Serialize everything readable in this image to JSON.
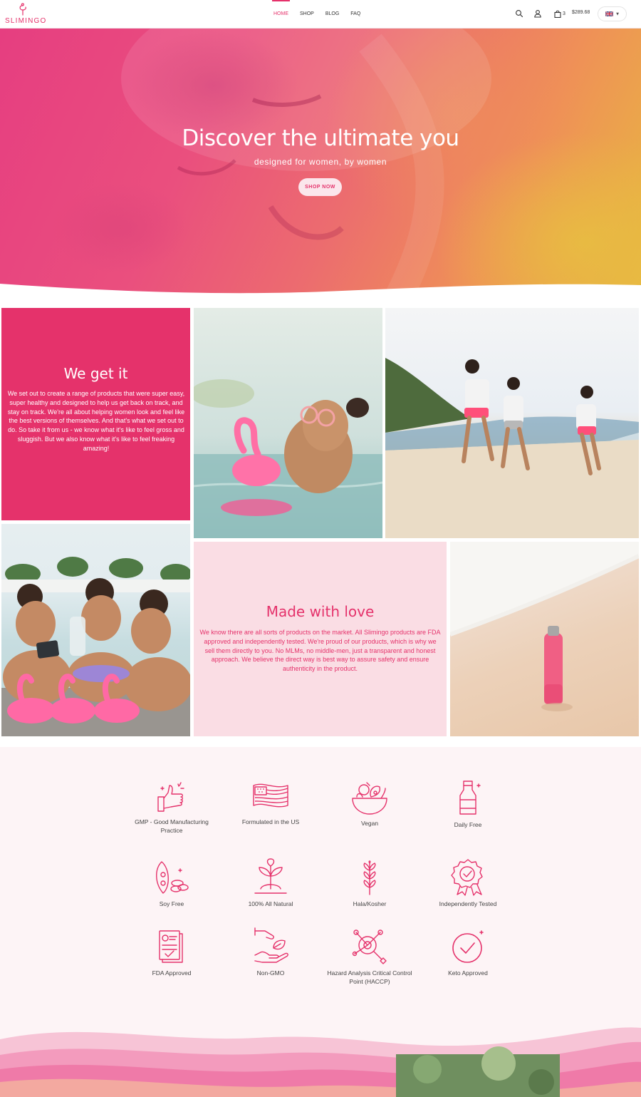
{
  "brand": {
    "logo_text": "SLIMINGO",
    "accent": "#e5326b"
  },
  "nav": {
    "items": [
      "HOME",
      "SHOP",
      "BLOG",
      "FAQ"
    ],
    "active": "HOME"
  },
  "header": {
    "cart_count": "3",
    "cart_total": "$289.68",
    "language": "UK flag"
  },
  "icons": {
    "search": "search-icon",
    "account": "user-icon",
    "cart": "shopping-bag-icon",
    "dropdown": "caret-down-icon"
  },
  "hero": {
    "title": "Discover the ultimate you",
    "subtitle": "designed for women, by women",
    "cta": "SHOP NOW"
  },
  "tiles": {
    "we_get_it": {
      "title": "We get it",
      "body": "We set out to create a range of products that were super easy, super healthy and designed to help us get back on track, and stay on track. We're all about helping women look and feel like the best versions of themselves. And that's what we set out to do. So take it from us - we know what it's like to feel gross and sluggish. But we also know what it's like to feel freaking amazing!"
    },
    "made_with_love": {
      "title": "Made with love",
      "body": "We know there are all sorts of products on the market. All Slimingo products are FDA approved and independently tested. We're proud of our products, which is why we sell them directly to you. No MLMs, no middle-men, just a transparent and honest approach. We believe the direct way is best way to assure safety and ensure authenticity in the product."
    },
    "photos": [
      "woman with flamingo float in pool",
      "three women running on beach",
      "friends with flamingo floats taking selfie",
      "pink bottle in sand"
    ]
  },
  "features": [
    {
      "label": "GMP - Good Manufacturing Practice",
      "icon": "thumbs-up-icon"
    },
    {
      "label": "Formulated in the US",
      "icon": "us-flag-icon"
    },
    {
      "label": "Vegan",
      "icon": "salad-bowl-icon"
    },
    {
      "label": "Daily Free",
      "icon": "milk-bottle-icon"
    },
    {
      "label": "Soy Free",
      "icon": "soy-bean-icon"
    },
    {
      "label": "100% All Natural",
      "icon": "plant-sprout-icon"
    },
    {
      "label": "Hala/Kosher",
      "icon": "wheat-icon"
    },
    {
      "label": "Independently Tested",
      "icon": "award-badge-icon"
    },
    {
      "label": "FDA Approved",
      "icon": "document-check-icon"
    },
    {
      "label": "Non-GMO",
      "icon": "hand-leaf-icon"
    },
    {
      "label": "Hazard Analysis Critical Control Point (HACCP)",
      "icon": "magnifier-analysis-icon"
    },
    {
      "label": "Keto Approved",
      "icon": "check-circle-icon"
    }
  ]
}
